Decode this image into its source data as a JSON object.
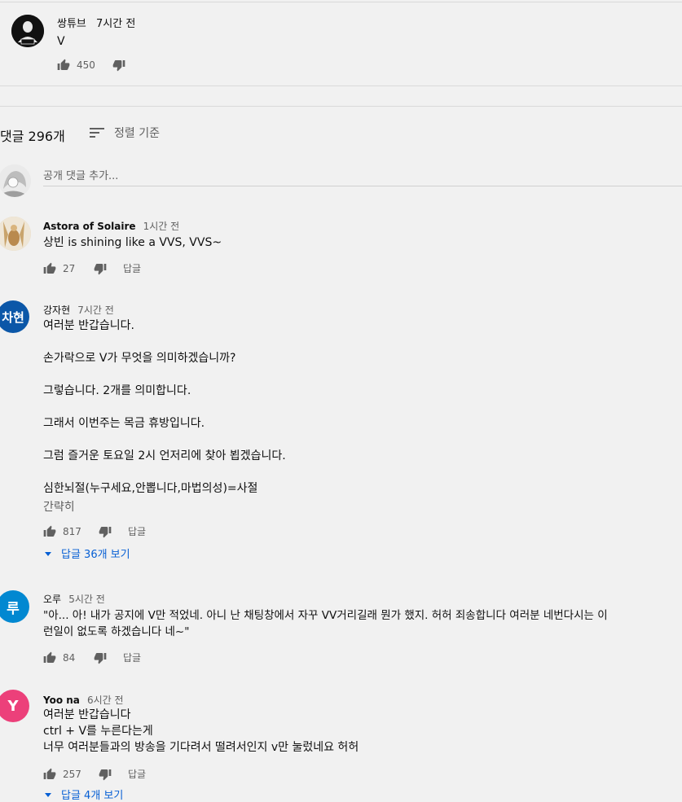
{
  "top_comment": {
    "author": "쌍튜브",
    "time": "7시간 전",
    "text": "V",
    "likes": "450"
  },
  "comments_header": {
    "count_label": "댓글 296개",
    "sort_label": "정렬 기준"
  },
  "add_comment": {
    "placeholder": "공개 댓글 추가..."
  },
  "comments": [
    {
      "author": "Astora of Solaire",
      "time": "1시간 전",
      "text": "상빈 is shining like a VVS, VVS~",
      "likes": "27",
      "reply_label": "답글"
    },
    {
      "author": "강자현",
      "avatar_text": "차현",
      "avatar_color": "#0b57a8",
      "time": "7시간 전",
      "text": "여러분 반갑습니다.\n\n손가락으로 V가 무엇을 의미하겠습니까?\n\n그렇습니다. 2개를 의미합니다.\n\n그래서 이번주는 목금 휴방입니다.\n\n그럼 즐거운 토요일 2시 언저리에 찾아 뵙겠습니다.\n\n심한뇌절(누구세요,안뽑니다,마법의성)=사절",
      "collapse_label": "간략히",
      "likes": "817",
      "reply_label": "답글",
      "replies_label": "답글 36개 보기"
    },
    {
      "author": "오루",
      "avatar_text": "루",
      "avatar_color": "#0288d1",
      "time": "5시간 전",
      "text": "\"아... 아! 내가 공지에 V만 적었네. 아니 난 채팅창에서 자꾸 VV거리길래 뭔가 했지. 허허 죄송합니다 여러분 네번다시는 이\n런일이 없도록 하겠습니다 네~\"",
      "likes": "84",
      "reply_label": "답글"
    },
    {
      "author": "Yoo na",
      "avatar_text": "Y",
      "avatar_color": "#ec407a",
      "time": "6시간 전",
      "text": "여러분 반갑습니다\nctrl + V를 누른다는게\n너무 여러분들과의 방송을 기다려서 떨려서인지 v만 눌렀네요 허허",
      "likes": "257",
      "reply_label": "답글",
      "replies_label": "답글 4개 보기"
    }
  ]
}
